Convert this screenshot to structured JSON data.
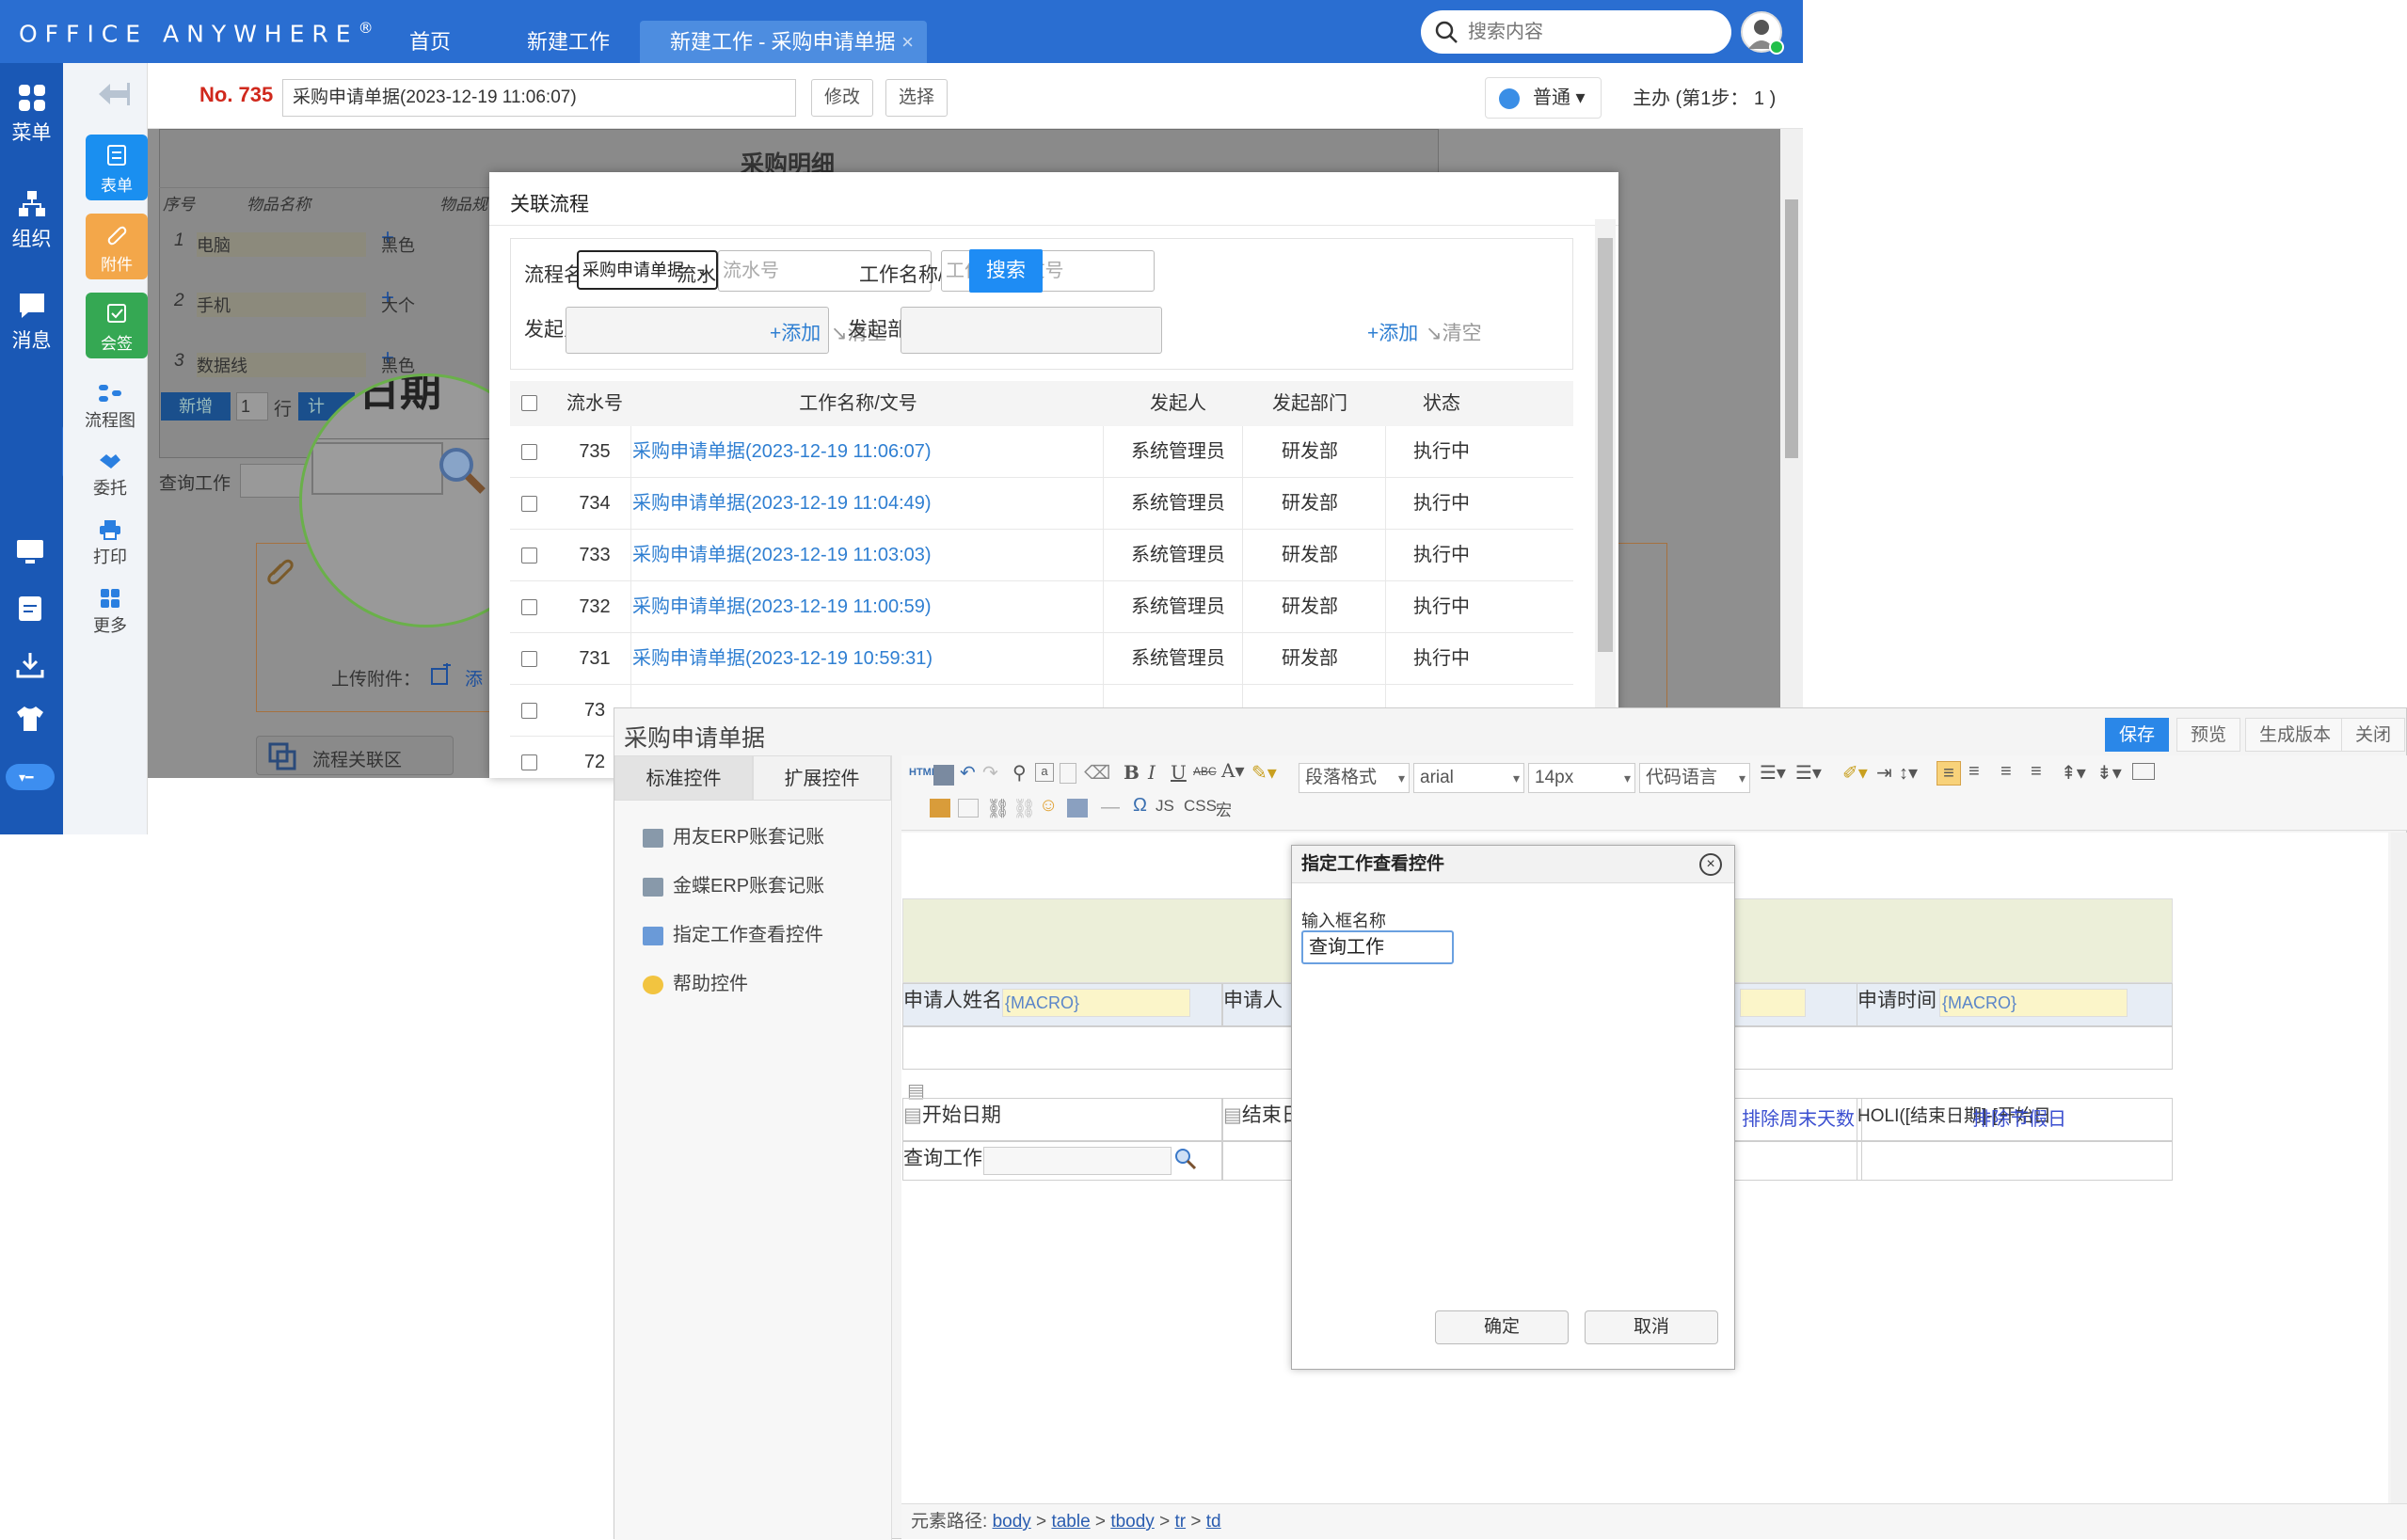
{
  "topbar": {
    "logo": "OFFICE ANYWHERE",
    "logo_mark": "®",
    "tabs": [
      "首页",
      "新建工作"
    ],
    "active_tab": "新建工作 - 采购申请单据",
    "active_tab_close": "×",
    "search_placeholder": "搜索内容"
  },
  "leftbar": {
    "items": [
      "菜单",
      "组织",
      "消息"
    ]
  },
  "col2": {
    "buttons": [
      "表单",
      "附件",
      "会签"
    ],
    "items": [
      "流程图",
      "委托",
      "打印",
      "更多"
    ]
  },
  "header": {
    "no": "No. 735",
    "title": "采购申请单据(2023-12-19 11:06:07)",
    "edit": "修改",
    "select": "选择",
    "priority": "普通",
    "step": "主办 (第1步： 1 )"
  },
  "background_form": {
    "section_title": "采购明细",
    "cols": [
      "序号",
      "物品名称",
      "物品规"
    ],
    "rows": [
      {
        "n": "1",
        "name": "电脑",
        "spec": "黑色"
      },
      {
        "n": "2",
        "name": "手机",
        "spec": "大个"
      },
      {
        "n": "3",
        "name": "数据线",
        "spec": "黑色"
      }
    ],
    "add_btn": "新增",
    "count": "1",
    "row_unit": "行",
    "calc": "计",
    "query_label": "查询工作",
    "date_text": "日期",
    "upload_label": "上传附件：",
    "upload_add": "添",
    "relation_area": "流程关联区"
  },
  "modal": {
    "title": "关联流程",
    "flow_name_label": "流程名称:",
    "flow_name_value": "采购申请单据",
    "serial_label": "流水号:",
    "serial_placeholder": "流水号",
    "work_label": "工作名称/文号:",
    "work_placeholder": "工作名称/文号",
    "search": "搜索",
    "initiator_label": "发起人:",
    "dept_label": "发起部门:",
    "add": "+添加",
    "clear": "清空",
    "table": {
      "headers": [
        "流水号",
        "工作名称/文号",
        "发起人",
        "发起部门",
        "状态"
      ],
      "rows": [
        {
          "id": "735",
          "name": "采购申请单据(2023-12-19 11:06:07)",
          "user": "系统管理员",
          "dept": "研发部",
          "status": "执行中"
        },
        {
          "id": "734",
          "name": "采购申请单据(2023-12-19 11:04:49)",
          "user": "系统管理员",
          "dept": "研发部",
          "status": "执行中"
        },
        {
          "id": "733",
          "name": "采购申请单据(2023-12-19 11:03:03)",
          "user": "系统管理员",
          "dept": "研发部",
          "status": "执行中"
        },
        {
          "id": "732",
          "name": "采购申请单据(2023-12-19 11:00:59)",
          "user": "系统管理员",
          "dept": "研发部",
          "status": "执行中"
        },
        {
          "id": "731",
          "name": "采购申请单据(2023-12-19 10:59:31)",
          "user": "系统管理员",
          "dept": "研发部",
          "status": "执行中"
        },
        {
          "id": "73",
          "name": "",
          "user": "",
          "dept": "",
          "status": ""
        },
        {
          "id": "72",
          "name": "",
          "user": "",
          "dept": "",
          "status": ""
        }
      ]
    }
  },
  "editor": {
    "title": "采购申请单据",
    "buttons": [
      "保存",
      "预览",
      "生成版本",
      "关闭"
    ],
    "tabs": [
      "标准控件",
      "扩展控件"
    ],
    "controls": [
      "用友ERP账套记账",
      "金蝶ERP账套记账",
      "指定工作查看控件",
      "帮助控件"
    ],
    "toolbar": {
      "para": "段落格式",
      "font": "arial",
      "size": "14px",
      "code": "代码语言",
      "js": "JS",
      "css": "CSS",
      "macro": "宏",
      "omega": "Ω",
      "html": "HTML"
    },
    "form": {
      "applicant_name": "申请人姓名",
      "macro": "{MACRO}",
      "applicant": "申请人",
      "apply_time": "申请时间",
      "start_date": "开始日期",
      "end_date": "结束日",
      "exclude_weekend": "排除周末天数",
      "holi": "HOLI([结束日期]-[开始日",
      "exclude_holiday": "排除节假日",
      "query_work": "查询工作"
    },
    "status": {
      "label": "元素路径:",
      "path": [
        "body",
        "table",
        "tbody",
        "tr",
        "td"
      ],
      "sep": ">"
    }
  },
  "dialog": {
    "title": "指定工作查看控件",
    "label": "输入框名称",
    "value": "查询工作",
    "ok": "确定",
    "cancel": "取消",
    "close": "×"
  },
  "colors": {
    "brand": "#2a6ed1",
    "sidebar": "#1a58b5",
    "link": "#2f7fd2",
    "alert": "#d0281c"
  }
}
